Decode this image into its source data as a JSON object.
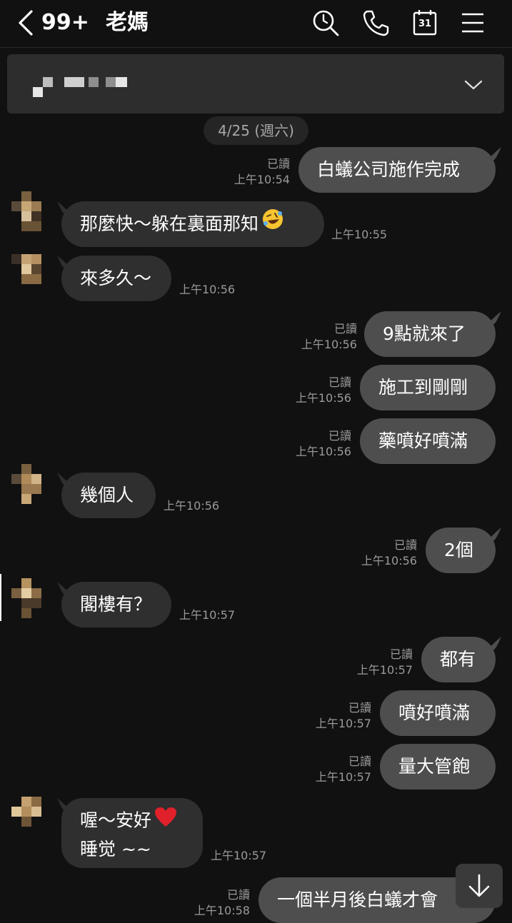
{
  "header": {
    "unread_count": "99+",
    "contact_name": "老媽"
  },
  "calendar_day": "31",
  "date_separator": "4/25 (週六)",
  "messages": [
    {
      "side": "out",
      "text": "白蟻公司施作完成",
      "read": "已讀",
      "time": "上午10:54"
    },
    {
      "side": "in",
      "text": "那麼快～躲在裏面那知",
      "time": "上午10:55",
      "emoji": "rolling-on-floor-laughing"
    },
    {
      "side": "in",
      "text": "來多久～",
      "time": "上午10:56"
    },
    {
      "side": "out",
      "text": "9點就來了",
      "read": "已讀",
      "time": "上午10:56"
    },
    {
      "side": "out",
      "text": "施工到剛剛",
      "read": "已讀",
      "time": "上午10:56"
    },
    {
      "side": "out",
      "text": "藥噴好噴滿",
      "read": "已讀",
      "time": "上午10:56"
    },
    {
      "side": "in",
      "text": "幾個人",
      "time": "上午10:56"
    },
    {
      "side": "out",
      "text": "2個",
      "read": "已讀",
      "time": "上午10:56"
    },
    {
      "side": "in",
      "text": "閣樓有？",
      "time": "上午10:57"
    },
    {
      "side": "out",
      "text": "都有",
      "read": "已讀",
      "time": "上午10:57"
    },
    {
      "side": "out",
      "text": "噴好噴滿",
      "read": "已讀",
      "time": "上午10:57"
    },
    {
      "side": "out",
      "text": "量大管飽",
      "read": "已讀",
      "time": "上午10:57"
    },
    {
      "side": "in",
      "line1": "喔～安好",
      "line2": "睡觉 ~~",
      "time": "上午10:57",
      "emoji": "red-heart"
    },
    {
      "side": "out",
      "text": "一個半月後白蟻才會",
      "read": "已讀",
      "time": "上午10:58"
    }
  ]
}
